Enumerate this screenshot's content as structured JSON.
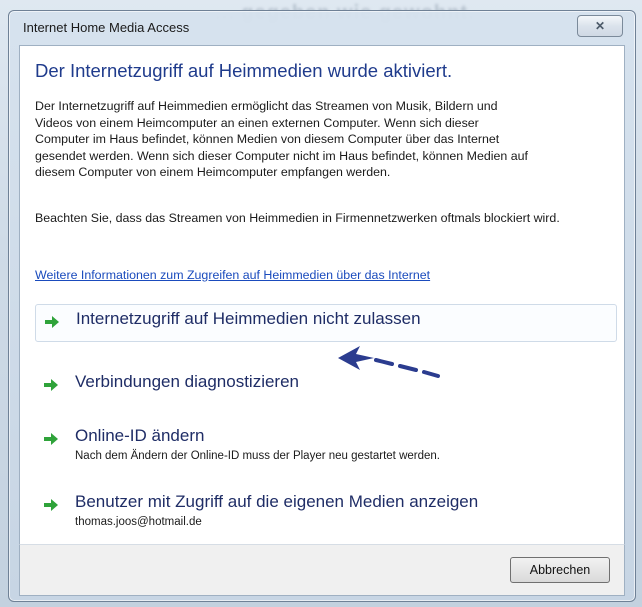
{
  "window": {
    "title": "Internet Home Media Access",
    "close_glyph": "✕"
  },
  "background_text": "... gegeben wie gewohnt.",
  "content": {
    "heading": "Der Internetzugriff auf Heimmedien wurde aktiviert.",
    "description": "Der Internetzugriff auf Heimmedien ermöglicht das Streamen von Musik, Bildern und\nVideos von einem Heimcomputer an einen externen Computer. Wenn sich dieser\nComputer im Haus befindet, können Medien von diesem Computer über das Internet\ngesendet werden. Wenn sich dieser Computer nicht im Haus befindet, können Medien auf\ndiesem Computer von einem Heimcomputer empfangen werden.",
    "note": "Beachten Sie, dass das Streamen von Heimmedien in Firmennetzwerken oftmals blockiert wird.",
    "link": "Weitere Informationen zum Zugreifen auf Heimmedien über das Internet",
    "options": [
      {
        "title": "Internetzugriff auf Heimmedien nicht zulassen",
        "subtitle": "",
        "icon": "green-arrow-icon"
      },
      {
        "title": "Verbindungen diagnostizieren",
        "subtitle": "",
        "icon": "green-arrow-icon"
      },
      {
        "title": "Online-ID ändern",
        "subtitle": "Nach dem Ändern der Online-ID muss der Player neu gestartet werden.",
        "icon": "green-arrow-icon"
      },
      {
        "title": "Benutzer mit Zugriff auf die eigenen Medien anzeigen",
        "subtitle": "thomas.joos@hotmail.de",
        "icon": "green-arrow-icon"
      }
    ]
  },
  "footer": {
    "cancel_label": "Abbrechen"
  },
  "colors": {
    "heading": "#1f3b8c",
    "link": "#1a4bbd",
    "arrow": "#2fa33a",
    "pointer": "#2b3c8f"
  }
}
